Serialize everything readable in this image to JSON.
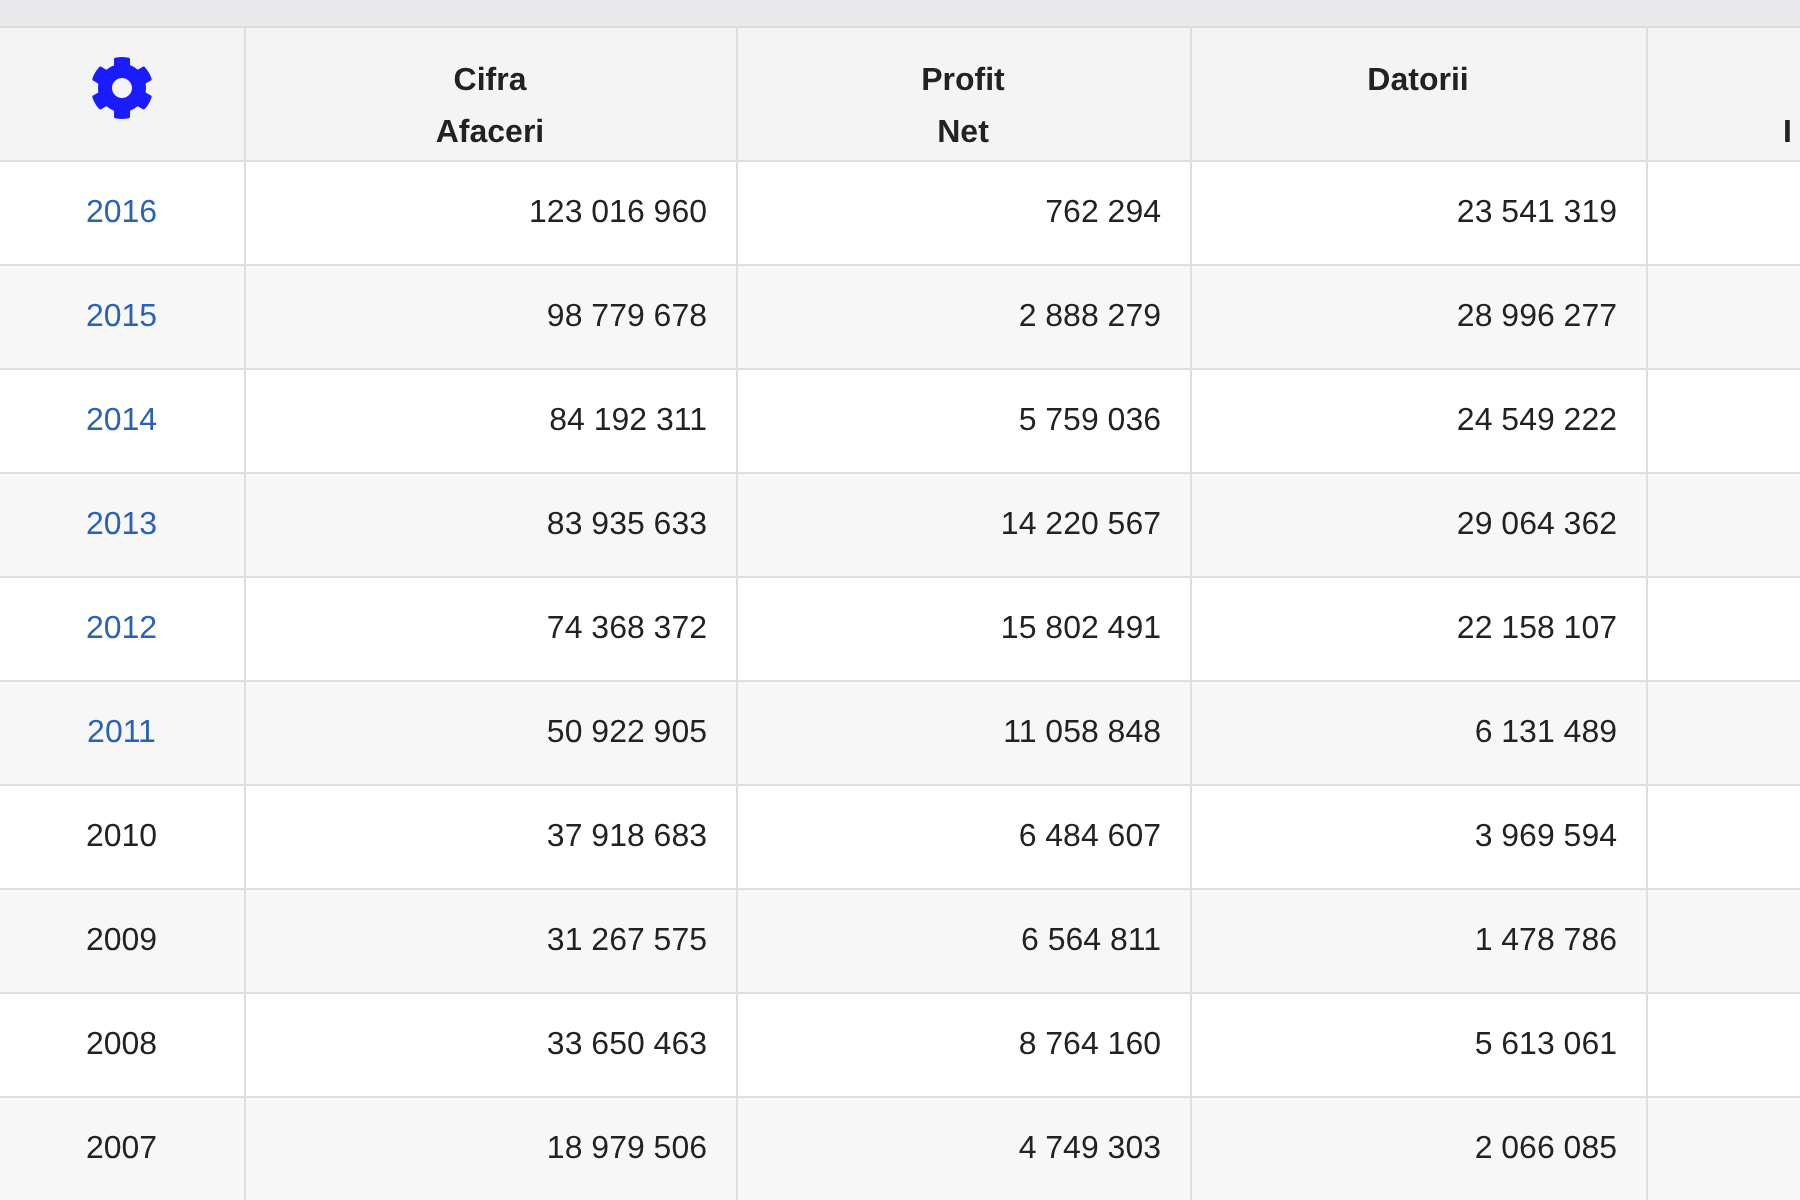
{
  "table": {
    "columns": [
      {
        "kind": "settings"
      },
      {
        "kind": "text",
        "lines": [
          "Cifra",
          "Afaceri"
        ]
      },
      {
        "kind": "text",
        "lines": [
          "Profit",
          "Net"
        ]
      },
      {
        "kind": "text",
        "lines": [
          "Datorii"
        ]
      },
      {
        "kind": "partial",
        "lines": [
          "I"
        ]
      }
    ],
    "rows": [
      {
        "link": true,
        "cells": [
          "2016",
          "123 016 960",
          "762 294",
          "23 541 319"
        ]
      },
      {
        "link": true,
        "cells": [
          "2015",
          "98 779 678",
          "2 888 279",
          "28 996 277"
        ]
      },
      {
        "link": true,
        "cells": [
          "2014",
          "84 192 311",
          "5 759 036",
          "24 549 222"
        ]
      },
      {
        "link": true,
        "cells": [
          "2013",
          "83 935 633",
          "14 220 567",
          "29 064 362"
        ]
      },
      {
        "link": true,
        "cells": [
          "2012",
          "74 368 372",
          "15 802 491",
          "22 158 107"
        ]
      },
      {
        "link": true,
        "cells": [
          "2011",
          "50 922 905",
          "11 058 848",
          "6 131 489"
        ]
      },
      {
        "link": false,
        "cells": [
          "2010",
          "37 918 683",
          "6 484 607",
          "3 969 594"
        ]
      },
      {
        "link": false,
        "cells": [
          "2009",
          "31 267 575",
          "6 564 811",
          "1 478 786"
        ]
      },
      {
        "link": false,
        "cells": [
          "2008",
          "33 650 463",
          "8 764 160",
          "5 613 061"
        ]
      },
      {
        "link": false,
        "cells": [
          "2007",
          "18 979 506",
          "4 749 303",
          "2 066 085"
        ]
      }
    ]
  }
}
